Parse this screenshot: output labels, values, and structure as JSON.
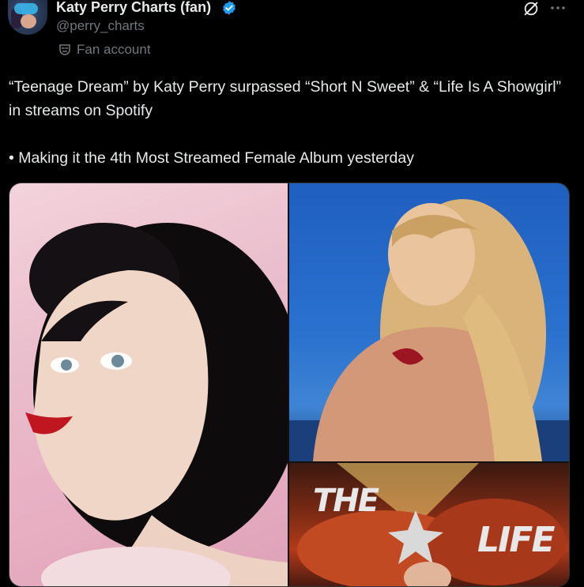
{
  "author": {
    "name": "Katy Perry Charts (fan)",
    "handle": "@perry_charts",
    "badge": "Fan account",
    "verified_color": "#1d9bf0"
  },
  "actions": {
    "grok_icon": "grok-icon",
    "more_icon": "more-icon"
  },
  "tweet": {
    "line1": "“Teenage Dream” by Katy Perry surpassed “Short N Sweet” & “Life Is A Showgirl” in streams on Spotify",
    "line2": "• Making it the 4th Most Streamed Female Album yesterday"
  },
  "media": {
    "album_text_1": "THE",
    "album_text_2": "LIFE"
  },
  "colors": {
    "background": "#000000",
    "text": "#e7e9ea",
    "muted": "#71767b",
    "accent": "#1d9bf0"
  }
}
